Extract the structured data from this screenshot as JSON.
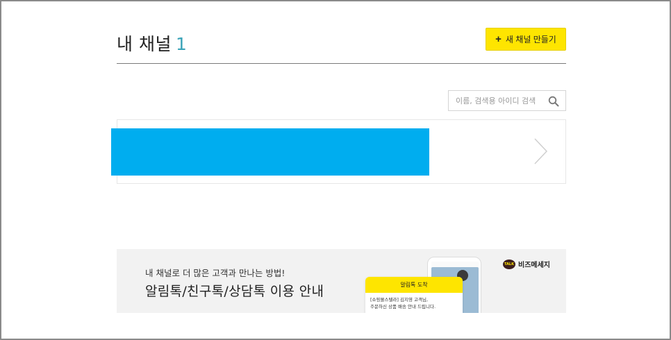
{
  "header": {
    "title": "내 채널",
    "count": "1",
    "new_channel_button": "새 채널 만들기"
  },
  "search": {
    "placeholder": "이름, 검색용 아이디 검색"
  },
  "channel_list": {
    "items": [
      {
        "name": ""
      }
    ]
  },
  "banner": {
    "subtitle": "내 채널로 더 많은 고객과 만나는 방법!",
    "title": "알림톡/친구톡/상담톡 이용 안내",
    "brand": "비즈메세지",
    "brand_badge": "TALK",
    "preview": {
      "header": "알림톡 도착",
      "body_line1": "[쇼핑몰스텔라] 김지영 고객님,",
      "body_line2": "주문하신 상품 배송 안내 드립니다."
    }
  },
  "colors": {
    "accent_yellow": "#fee500",
    "count_teal": "#3aa3b8",
    "redaction_blue": "#00adef"
  }
}
